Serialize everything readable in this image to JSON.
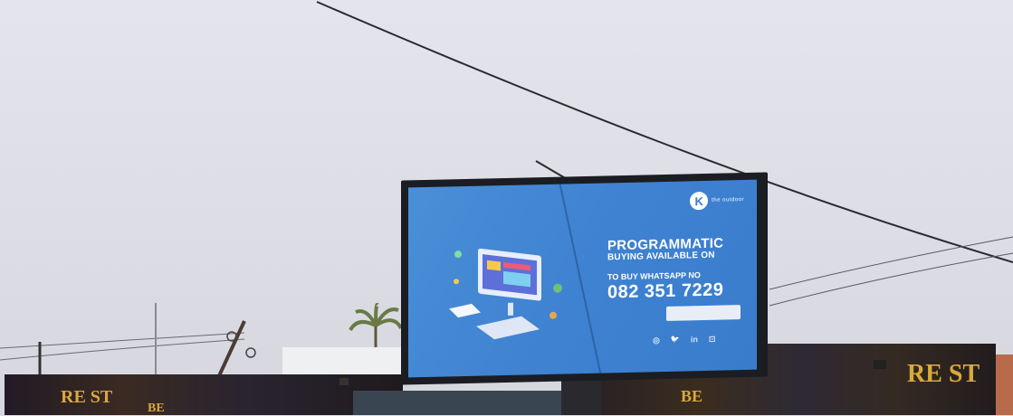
{
  "billboard": {
    "brand_initial": "K",
    "brand_text": "the outdoor",
    "headline_line1": "PROGRAMMATIC",
    "headline_line2": "BUYING AVAILABLE ON",
    "cta_label": "TO BUY WHATSAPP NO",
    "phone_number": "082 351 7229",
    "social_icons": [
      "instagram-icon",
      "twitter-icon",
      "linkedin-icon",
      "website-icon"
    ],
    "social_glyphs": [
      "◎",
      "🐦",
      "in",
      "⊡"
    ]
  },
  "lower_signage": {
    "left_text": "RE ST",
    "middle_text": "BE",
    "right_text": "RE ST"
  },
  "colors": {
    "sky": "#dfe0e7",
    "billboard_screen": "#4086d4",
    "billboard_frame": "#1b1d22",
    "hoarding": "#1f1a1c",
    "hoarding_text": "#d9a93a"
  }
}
